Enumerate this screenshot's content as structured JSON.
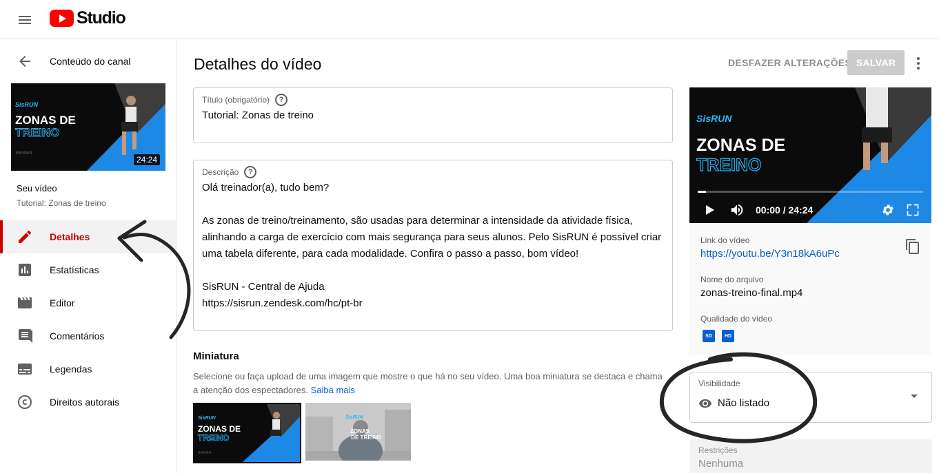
{
  "header": {
    "logo_text": "Studio"
  },
  "sidebar": {
    "back_label": "Conteúdo do canal",
    "thumbnail": {
      "brand": "SisRUN",
      "line1": "ZONAS DE",
      "line2": "TREINO",
      "duration": "24:24"
    },
    "your_video_label": "Seu vídeo",
    "your_video_title": "Tutorial: Zonas de treino",
    "items": [
      {
        "label": "Detalhes",
        "icon": "pencil-icon",
        "active": true
      },
      {
        "label": "Estatísticas",
        "icon": "bar-chart-icon",
        "active": false
      },
      {
        "label": "Editor",
        "icon": "clapperboard-icon",
        "active": false
      },
      {
        "label": "Comentários",
        "icon": "comment-icon",
        "active": false
      },
      {
        "label": "Legendas",
        "icon": "subtitles-icon",
        "active": false
      },
      {
        "label": "Direitos autorais",
        "icon": "copyright-icon",
        "active": false
      }
    ]
  },
  "main": {
    "page_title": "Detalhes do vídeo",
    "undo_label": "DESFAZER ALTERAÇÕES",
    "save_label": "SALVAR",
    "title_field": {
      "label": "Título (obrigatório)",
      "value": "Tutorial: Zonas de treino"
    },
    "description_field": {
      "label": "Descrição",
      "lines": [
        "Olá treinador(a), tudo bem?",
        "",
        "As zonas de treino/treinamento, são usadas para determinar a intensidade da atividade física,",
        "alinhando a carga de exercício com mais segurança para seus alunos. Pelo SisRUN é possível criar",
        "uma tabela diferente, para cada modalidade. Confira o passo a passo, bom vídeo!",
        "",
        "SisRUN - Central de Ajuda",
        "https://sisrun.zendesk.com/hc/pt-br"
      ]
    },
    "thumbnail_section": {
      "title": "Miniatura",
      "description": "Selecione ou faça upload de uma imagem que mostre o que há no seu vídeo. Uma boa miniatura se destaca e chama a atenção dos espectadores.",
      "learn_more": "Saiba mais",
      "options": [
        {
          "brand": "SisRUN",
          "line1": "ZONAS DE",
          "line2": "TREINO",
          "selected": true
        },
        {
          "brand": "SisRUN",
          "line1": "ZONAS",
          "line2": "DE TREINO",
          "selected": false
        }
      ]
    }
  },
  "right_panel": {
    "preview": {
      "brand": "SisRUN",
      "line1": "ZONAS DE",
      "line2": "TREINO",
      "time": "00:00 / 24:24"
    },
    "link_label": "Link do vídeo",
    "link_value": "https://youtu.be/Y3n18kA6uPc",
    "filename_label": "Nome do arquivo",
    "filename_value": "zonas-treino-final.mp4",
    "quality_label": "Qualidade do vídeo",
    "quality_badges": [
      "SD",
      "HD"
    ],
    "visibility": {
      "label": "Visibilidade",
      "value": "Não listado"
    },
    "restrictions": {
      "label": "Restrições",
      "value": "Nenhuma"
    }
  },
  "colors": {
    "accent_red": "#cc0000",
    "link_blue": "#065fd4",
    "thumb_blue": "#1e88e5"
  }
}
